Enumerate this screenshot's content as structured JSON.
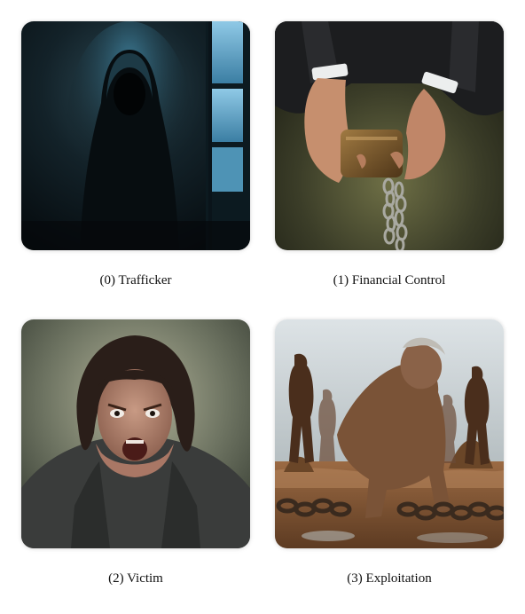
{
  "panels": [
    {
      "caption": "(0) Trafficker"
    },
    {
      "caption": "(1) Financial Control"
    },
    {
      "caption": "(2) Victim"
    },
    {
      "caption": "(3) Exploitation"
    }
  ]
}
